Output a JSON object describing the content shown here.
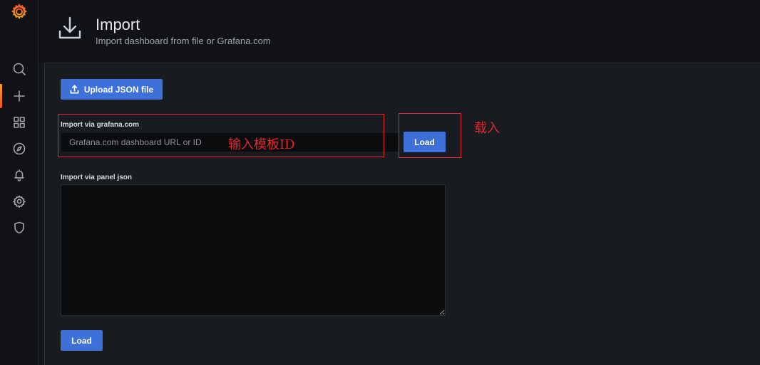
{
  "sidebar": {
    "items": [
      {
        "icon": "search-icon"
      },
      {
        "icon": "plus-icon"
      },
      {
        "icon": "dashboards-icon"
      },
      {
        "icon": "compass-icon"
      },
      {
        "icon": "bell-icon"
      },
      {
        "icon": "gear-icon"
      },
      {
        "icon": "shield-icon"
      }
    ],
    "logo": "grafana-logo"
  },
  "header": {
    "icon": "import-icon",
    "title": "Import",
    "subtitle": "Import dashboard from file or Grafana.com"
  },
  "upload": {
    "label": "Upload JSON file",
    "icon": "upload-icon"
  },
  "grafana_import": {
    "label": "Import via grafana.com",
    "value": "",
    "placeholder": "Grafana.com dashboard URL or ID",
    "load_label": "Load"
  },
  "panel_import": {
    "label": "Import via panel json",
    "value": "",
    "load_label": "Load"
  },
  "annotations": {
    "input_note": "输入模板ID",
    "load_note": "载入",
    "color": "#e0282e"
  },
  "colors": {
    "primary_button": "#3d71d9",
    "background": "#161719",
    "accent": "#f9a31e"
  }
}
